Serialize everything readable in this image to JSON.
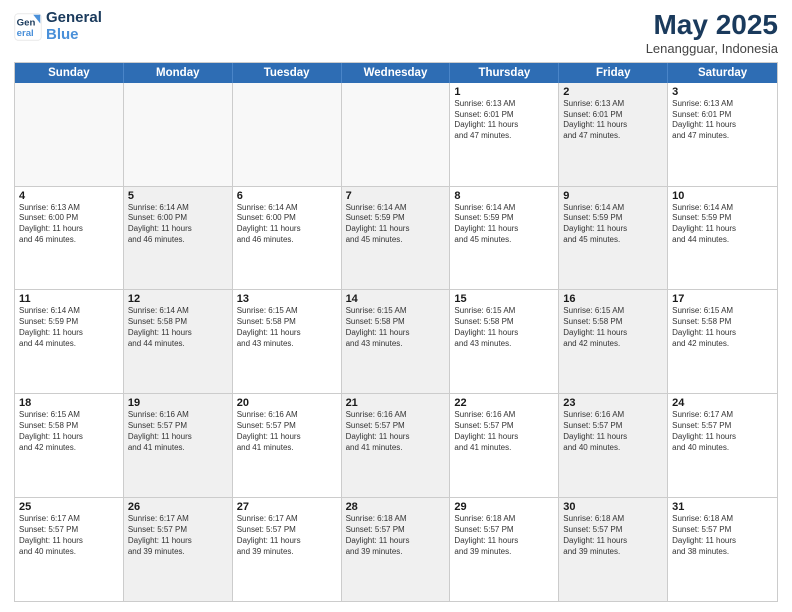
{
  "logo": {
    "line1": "General",
    "line2": "Blue"
  },
  "title": "May 2025",
  "subtitle": "Lenangguar, Indonesia",
  "days": [
    "Sunday",
    "Monday",
    "Tuesday",
    "Wednesday",
    "Thursday",
    "Friday",
    "Saturday"
  ],
  "rows": [
    [
      {
        "day": "",
        "text": "",
        "shaded": false,
        "empty": true
      },
      {
        "day": "",
        "text": "",
        "shaded": false,
        "empty": true
      },
      {
        "day": "",
        "text": "",
        "shaded": false,
        "empty": true
      },
      {
        "day": "",
        "text": "",
        "shaded": false,
        "empty": true
      },
      {
        "day": "1",
        "text": "Sunrise: 6:13 AM\nSunset: 6:01 PM\nDaylight: 11 hours\nand 47 minutes.",
        "shaded": false
      },
      {
        "day": "2",
        "text": "Sunrise: 6:13 AM\nSunset: 6:01 PM\nDaylight: 11 hours\nand 47 minutes.",
        "shaded": true
      },
      {
        "day": "3",
        "text": "Sunrise: 6:13 AM\nSunset: 6:01 PM\nDaylight: 11 hours\nand 47 minutes.",
        "shaded": false
      }
    ],
    [
      {
        "day": "4",
        "text": "Sunrise: 6:13 AM\nSunset: 6:00 PM\nDaylight: 11 hours\nand 46 minutes.",
        "shaded": false
      },
      {
        "day": "5",
        "text": "Sunrise: 6:14 AM\nSunset: 6:00 PM\nDaylight: 11 hours\nand 46 minutes.",
        "shaded": true
      },
      {
        "day": "6",
        "text": "Sunrise: 6:14 AM\nSunset: 6:00 PM\nDaylight: 11 hours\nand 46 minutes.",
        "shaded": false
      },
      {
        "day": "7",
        "text": "Sunrise: 6:14 AM\nSunset: 5:59 PM\nDaylight: 11 hours\nand 45 minutes.",
        "shaded": true
      },
      {
        "day": "8",
        "text": "Sunrise: 6:14 AM\nSunset: 5:59 PM\nDaylight: 11 hours\nand 45 minutes.",
        "shaded": false
      },
      {
        "day": "9",
        "text": "Sunrise: 6:14 AM\nSunset: 5:59 PM\nDaylight: 11 hours\nand 45 minutes.",
        "shaded": true
      },
      {
        "day": "10",
        "text": "Sunrise: 6:14 AM\nSunset: 5:59 PM\nDaylight: 11 hours\nand 44 minutes.",
        "shaded": false
      }
    ],
    [
      {
        "day": "11",
        "text": "Sunrise: 6:14 AM\nSunset: 5:59 PM\nDaylight: 11 hours\nand 44 minutes.",
        "shaded": false
      },
      {
        "day": "12",
        "text": "Sunrise: 6:14 AM\nSunset: 5:58 PM\nDaylight: 11 hours\nand 44 minutes.",
        "shaded": true
      },
      {
        "day": "13",
        "text": "Sunrise: 6:15 AM\nSunset: 5:58 PM\nDaylight: 11 hours\nand 43 minutes.",
        "shaded": false
      },
      {
        "day": "14",
        "text": "Sunrise: 6:15 AM\nSunset: 5:58 PM\nDaylight: 11 hours\nand 43 minutes.",
        "shaded": true
      },
      {
        "day": "15",
        "text": "Sunrise: 6:15 AM\nSunset: 5:58 PM\nDaylight: 11 hours\nand 43 minutes.",
        "shaded": false
      },
      {
        "day": "16",
        "text": "Sunrise: 6:15 AM\nSunset: 5:58 PM\nDaylight: 11 hours\nand 42 minutes.",
        "shaded": true
      },
      {
        "day": "17",
        "text": "Sunrise: 6:15 AM\nSunset: 5:58 PM\nDaylight: 11 hours\nand 42 minutes.",
        "shaded": false
      }
    ],
    [
      {
        "day": "18",
        "text": "Sunrise: 6:15 AM\nSunset: 5:58 PM\nDaylight: 11 hours\nand 42 minutes.",
        "shaded": false
      },
      {
        "day": "19",
        "text": "Sunrise: 6:16 AM\nSunset: 5:57 PM\nDaylight: 11 hours\nand 41 minutes.",
        "shaded": true
      },
      {
        "day": "20",
        "text": "Sunrise: 6:16 AM\nSunset: 5:57 PM\nDaylight: 11 hours\nand 41 minutes.",
        "shaded": false
      },
      {
        "day": "21",
        "text": "Sunrise: 6:16 AM\nSunset: 5:57 PM\nDaylight: 11 hours\nand 41 minutes.",
        "shaded": true
      },
      {
        "day": "22",
        "text": "Sunrise: 6:16 AM\nSunset: 5:57 PM\nDaylight: 11 hours\nand 41 minutes.",
        "shaded": false
      },
      {
        "day": "23",
        "text": "Sunrise: 6:16 AM\nSunset: 5:57 PM\nDaylight: 11 hours\nand 40 minutes.",
        "shaded": true
      },
      {
        "day": "24",
        "text": "Sunrise: 6:17 AM\nSunset: 5:57 PM\nDaylight: 11 hours\nand 40 minutes.",
        "shaded": false
      }
    ],
    [
      {
        "day": "25",
        "text": "Sunrise: 6:17 AM\nSunset: 5:57 PM\nDaylight: 11 hours\nand 40 minutes.",
        "shaded": false
      },
      {
        "day": "26",
        "text": "Sunrise: 6:17 AM\nSunset: 5:57 PM\nDaylight: 11 hours\nand 39 minutes.",
        "shaded": true
      },
      {
        "day": "27",
        "text": "Sunrise: 6:17 AM\nSunset: 5:57 PM\nDaylight: 11 hours\nand 39 minutes.",
        "shaded": false
      },
      {
        "day": "28",
        "text": "Sunrise: 6:18 AM\nSunset: 5:57 PM\nDaylight: 11 hours\nand 39 minutes.",
        "shaded": true
      },
      {
        "day": "29",
        "text": "Sunrise: 6:18 AM\nSunset: 5:57 PM\nDaylight: 11 hours\nand 39 minutes.",
        "shaded": false
      },
      {
        "day": "30",
        "text": "Sunrise: 6:18 AM\nSunset: 5:57 PM\nDaylight: 11 hours\nand 39 minutes.",
        "shaded": true
      },
      {
        "day": "31",
        "text": "Sunrise: 6:18 AM\nSunset: 5:57 PM\nDaylight: 11 hours\nand 38 minutes.",
        "shaded": false
      }
    ]
  ]
}
